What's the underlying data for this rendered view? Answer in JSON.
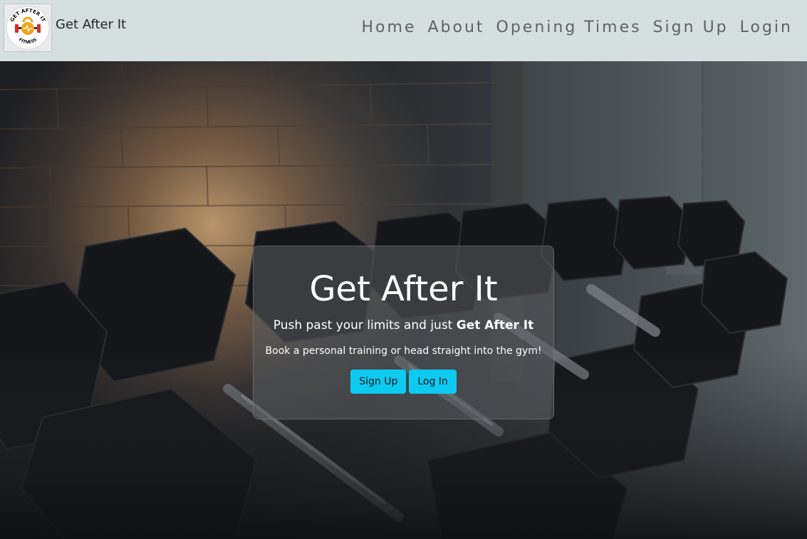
{
  "navbar": {
    "brand_name": "Get After It",
    "logo": {
      "icon": "kettlebell-logo-icon",
      "top_text": "GET AFTER IT",
      "bottom_text": "FITNESS"
    },
    "links": [
      "Home",
      "About",
      "Opening Times",
      "Sign Up",
      "Login"
    ]
  },
  "hero": {
    "background": "dumbbell-rack-photo",
    "title": "Get After It",
    "subtitle_prefix": "Push past your limits and just ",
    "subtitle_bold": "Get After It",
    "tagline": "Book a personal training or head straight into the gym!",
    "buttons": {
      "signup": "Sign Up",
      "login": "Log In"
    }
  },
  "colors": {
    "navbar_bg": "#d6dfe0",
    "nav_link": "#5e6268",
    "button_bg": "#0dcaf0",
    "card_bg": "rgba(90,92,96,0.55)"
  }
}
